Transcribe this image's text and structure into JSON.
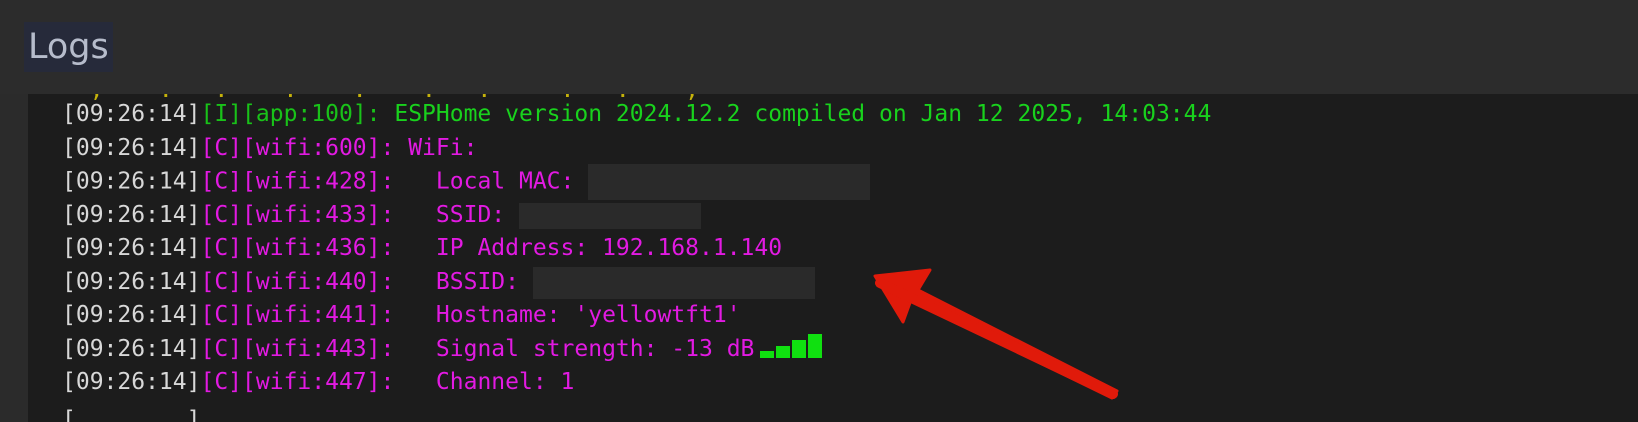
{
  "panel": {
    "title": "Logs"
  },
  "colors": {
    "timestamp": "#d8d8d8",
    "info": "#19c219",
    "config": "#e21ae2",
    "annotation_arrow": "#e01a0a",
    "signal_bars": "#10e010"
  },
  "logs": [
    {
      "time": "[09:26:14]",
      "tag": "[I][app:100]:",
      "message": " ESPHome version 2024.12.2 compiled on Jan 12 2025, 14:03:44",
      "level": "info"
    },
    {
      "time": "[09:26:14]",
      "tag": "[C][wifi:600]:",
      "message": " WiFi:",
      "level": "config"
    },
    {
      "time": "[09:26:14]",
      "tag": "[C][wifi:428]:",
      "message": "   Local MAC: ",
      "level": "config",
      "redacted": true
    },
    {
      "time": "[09:26:14]",
      "tag": "[C][wifi:433]:",
      "message": "   SSID: ",
      "level": "config",
      "redacted": true
    },
    {
      "time": "[09:26:14]",
      "tag": "[C][wifi:436]:",
      "message": "   IP Address: 192.168.1.140",
      "level": "config"
    },
    {
      "time": "[09:26:14]",
      "tag": "[C][wifi:440]:",
      "message": "   BSSID: ",
      "level": "config",
      "redacted": true
    },
    {
      "time": "[09:26:14]",
      "tag": "[C][wifi:441]:",
      "message": "   Hostname: 'yellowtft1'",
      "level": "config"
    },
    {
      "time": "[09:26:14]",
      "tag": "[C][wifi:443]:",
      "message": "   Signal strength: -13 dB",
      "level": "config",
      "signal_bars": 4
    },
    {
      "time": "[09:26:14]",
      "tag": "[C][wifi:447]:",
      "message": "   Channel: 1",
      "level": "config"
    }
  ]
}
